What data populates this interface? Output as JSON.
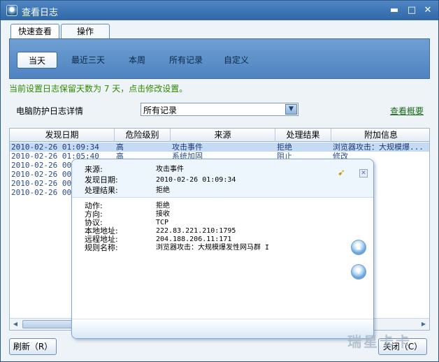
{
  "window": {
    "title": "查看日志"
  },
  "tabs": [
    "快速查看",
    "操作"
  ],
  "filters": [
    "当天",
    "最近三天",
    "本周",
    "所有记录",
    "自定义"
  ],
  "notice": "当前设置日志保留天数为 7 天，点击修改设置。",
  "section": {
    "label": "电脑防护日志详情",
    "select_value": "所有记录",
    "summary_link": "查看概要"
  },
  "table": {
    "columns": [
      "发现日期",
      "危险级别",
      "来源",
      "处理结果",
      "附加信息"
    ],
    "rows": [
      {
        "date": "2010-02-26 01:09:34",
        "level": "高",
        "source": "攻击事件",
        "result": "拒绝",
        "info": "浏览器攻击：大规模爆..."
      },
      {
        "date": "2010-02-26 01:05:40",
        "level": "高",
        "source": "系统加固",
        "result": "阻止",
        "info": "修改"
      },
      {
        "date": "2010-02-26 00:",
        "level": "",
        "source": "",
        "result": "",
        "info": ""
      },
      {
        "date": "2010-02-26 00:",
        "level": "",
        "source": "",
        "result": "",
        "info": ""
      },
      {
        "date": "2010-02-26 00:",
        "level": "",
        "source": "",
        "result": "",
        "info": ""
      },
      {
        "date": "2010-02-26 00:",
        "level": "",
        "source": "",
        "result": "",
        "info": ""
      }
    ]
  },
  "popup": {
    "head": [
      {
        "label": "来源:",
        "value": "攻击事件"
      },
      {
        "label": "发现日期:",
        "value": "2010-02-26 01:09:34"
      },
      {
        "label": "处理结果:",
        "value": "拒绝"
      }
    ],
    "details": [
      {
        "label": "动作:",
        "value": "拒绝"
      },
      {
        "label": "方向:",
        "value": "接收"
      },
      {
        "label": "协议:",
        "value": "TCP"
      },
      {
        "label": "本地地址:",
        "value": "222.83.221.210:1795"
      },
      {
        "label": "远程地址:",
        "value": "204.188.206.11:171"
      },
      {
        "label": "规则名称:",
        "value": "浏览器攻击：大规模爆发性网马群 I"
      }
    ]
  },
  "buttons": {
    "refresh": "刷新（R）",
    "close": "关闭（C）"
  },
  "watermark": "瑞星卡卡",
  "colors": {
    "accent": "#4f83c0",
    "notice": "#2f8a00",
    "selected_row": "#c5daf3"
  }
}
